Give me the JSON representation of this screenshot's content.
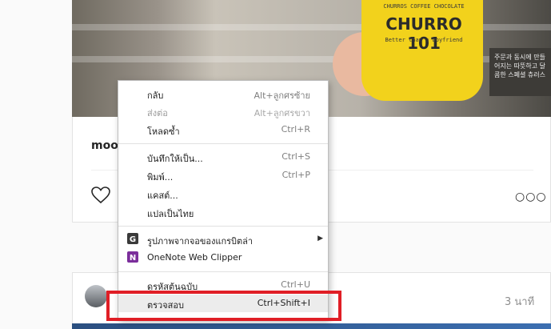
{
  "photo": {
    "cup_brand": "CHURRO 101",
    "cup_top_text": "CHURROS COFFEE CHOCOLATE",
    "cup_tagline": "Better than a boyfriend",
    "sign_text": "주문과 동시에 만들어지는 따뜻하고 달콤한 스페셜 츄러스"
  },
  "post": {
    "caption_prefix": "moo"
  },
  "post2": {
    "time": "3 นาที"
  },
  "context_menu": {
    "items": [
      {
        "label": "กลับ",
        "shortcut": "Alt+ลูกศรซ้าย",
        "disabled": false
      },
      {
        "label": "ส่งต่อ",
        "shortcut": "Alt+ลูกศรขวา",
        "disabled": true
      },
      {
        "label": "โหลดซ้ำ",
        "shortcut": "Ctrl+R",
        "disabled": false
      },
      {
        "label": "บันทึกให้เป็น...",
        "shortcut": "Ctrl+S",
        "disabled": false
      },
      {
        "label": "พิมพ์...",
        "shortcut": "Ctrl+P",
        "disabled": false
      },
      {
        "label": "แคสต์...",
        "shortcut": "",
        "disabled": false
      },
      {
        "label": "แปลเป็นไทย",
        "shortcut": "",
        "disabled": false
      },
      {
        "label": "รูปภาพจากจอของแกรบิตล่า",
        "shortcut": "",
        "icon": "grabber-extension-icon",
        "submenu": true
      },
      {
        "label": "OneNote Web Clipper",
        "shortcut": "",
        "icon": "onenote-icon"
      },
      {
        "label": "ดูรหัสต้นฉบับ",
        "shortcut": "Ctrl+U",
        "disabled": false
      },
      {
        "label": "ตรวจสอบ",
        "shortcut": "Ctrl+Shift+I",
        "disabled": false,
        "highlighted": true
      }
    ]
  },
  "colors": {
    "highlight_border": "#e01e26",
    "cup_yellow": "#f2d21c",
    "onenote_purple": "#7b2e9b"
  }
}
